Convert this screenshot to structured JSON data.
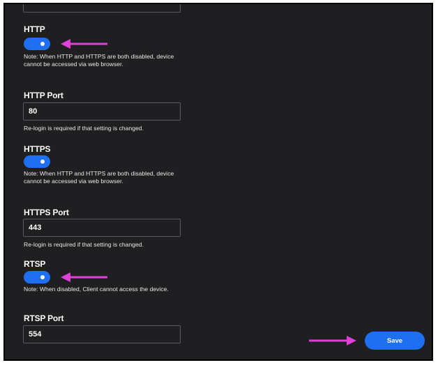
{
  "colors": {
    "accent": "#1f6ff1",
    "annotation_arrow": "#e040d8",
    "panel_bg": "#1f1f21"
  },
  "http": {
    "label": "HTTP",
    "enabled": true,
    "note": "Note: When HTTP and HTTPS are both disabled, device cannot be accessed via web browser."
  },
  "http_port": {
    "label": "HTTP Port",
    "value": "80",
    "hint": "Re-login is required if that setting is changed."
  },
  "https": {
    "label": "HTTPS",
    "enabled": true,
    "note": "Note: When HTTP and HTTPS are both disabled, device cannot be accessed via web browser."
  },
  "https_port": {
    "label": "HTTPS Port",
    "value": "443",
    "hint": "Re-login is required if that setting is changed."
  },
  "rtsp": {
    "label": "RTSP",
    "enabled": true,
    "note": "Note: When disabled, Client cannot access the device."
  },
  "rtsp_port": {
    "label": "RTSP Port",
    "value": "554"
  },
  "save_label": "Save",
  "icons": [
    "annotation-arrow-icon"
  ]
}
